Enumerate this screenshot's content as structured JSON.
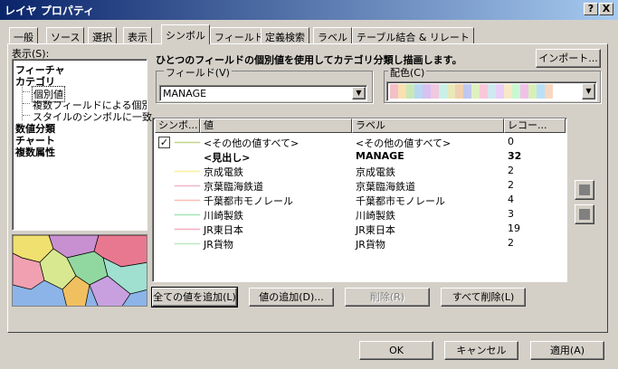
{
  "window": {
    "title": "レイヤ プロパティ",
    "help_button": "?",
    "close_button": "X"
  },
  "tabs": [
    {
      "label": "一般"
    },
    {
      "label": "ソース"
    },
    {
      "label": "選択"
    },
    {
      "label": "表示"
    },
    {
      "label": "シンボル"
    },
    {
      "label": "フィールド"
    },
    {
      "label": "定義検索"
    },
    {
      "label": "ラベル"
    },
    {
      "label": "テーブル結合 & リレート"
    }
  ],
  "left": {
    "display_label": "表示(S):",
    "tree": [
      {
        "label": "フィーチャ",
        "level": 0,
        "bold": true
      },
      {
        "label": "カテゴリ",
        "level": 0,
        "bold": true
      },
      {
        "label": "個別値",
        "level": 1,
        "bold": false
      },
      {
        "label": "複数フィールドによる個別値",
        "level": 1,
        "bold": false
      },
      {
        "label": "スタイルのシンボルに一致",
        "level": 1,
        "bold": false
      },
      {
        "label": "数値分類",
        "level": 0,
        "bold": true
      },
      {
        "label": "チャート",
        "level": 0,
        "bold": true
      },
      {
        "label": "複数属性",
        "level": 0,
        "bold": true
      }
    ]
  },
  "main": {
    "description": "ひとつのフィールドの個別値を使用してカテゴリ分類し描画します。",
    "import_button": "インポート...",
    "field_group_label": "フィールド(V)",
    "field_value": "MANAGE",
    "color_group_label": "配色(C)",
    "color_ramp": [
      "#f4c0c8",
      "#f8e0b0",
      "#c8e8b8",
      "#b8d8f0",
      "#d8c0f0",
      "#f0c8e0",
      "#c8f0e8",
      "#e8e8b8",
      "#f0d0b0",
      "#c0c8f0",
      "#e0f0c0",
      "#f8c8d8",
      "#d0e8f0",
      "#e8d0f8",
      "#f8e8c8",
      "#c8f8d0",
      "#f0c0e8",
      "#d8f0b8",
      "#b8e0f8",
      "#f8d8c0"
    ],
    "columns": {
      "symbol": "シンボ...",
      "value": "値",
      "label": "ラベル",
      "count": "レコー..."
    },
    "rows": [
      {
        "value": "<その他の値すべて>",
        "label": "<その他の値すべて>",
        "count": "0",
        "color": "#c8d890",
        "checked": true,
        "bold": false
      },
      {
        "value": "<見出し>",
        "label": "MANAGE",
        "count": "32",
        "color": "",
        "checked": false,
        "bold": true
      },
      {
        "value": "京成電鉄",
        "label": "京成電鉄",
        "count": "2",
        "color": "#f8f0a0",
        "checked": false,
        "bold": false
      },
      {
        "value": "京葉臨海鉄道",
        "label": "京葉臨海鉄道",
        "count": "2",
        "color": "#f0b8c8",
        "checked": false,
        "bold": false
      },
      {
        "value": "千葉都市モノレール",
        "label": "千葉都市モノレール",
        "count": "4",
        "color": "#f8c0b8",
        "checked": false,
        "bold": false
      },
      {
        "value": "川崎製鉄",
        "label": "川崎製鉄",
        "count": "3",
        "color": "#a8e8b8",
        "checked": false,
        "bold": false
      },
      {
        "value": "JR東日本",
        "label": "JR東日本",
        "count": "19",
        "color": "#f8b0c0",
        "checked": false,
        "bold": false
      },
      {
        "value": "JR貨物",
        "label": "JR貨物",
        "count": "2",
        "color": "#c0e8c0",
        "checked": false,
        "bold": false
      }
    ],
    "buttons": {
      "add_all": "全ての値を追加(L)",
      "add_value": "値の追加(D)...",
      "remove": "削除(R)",
      "remove_all": "すべて削除(L)"
    }
  },
  "footer": {
    "ok": "OK",
    "cancel": "キャンセル",
    "apply": "適用(A)"
  }
}
